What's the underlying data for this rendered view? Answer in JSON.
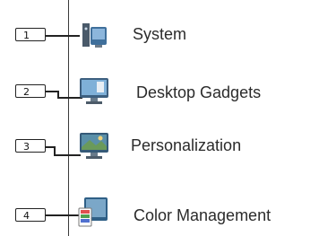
{
  "items": [
    {
      "number": "1",
      "label": "System",
      "icon": "system-icon"
    },
    {
      "number": "2",
      "label": "Desktop Gadgets",
      "icon": "desktop-gadgets-icon"
    },
    {
      "number": "3",
      "label": "Personalization",
      "icon": "personalization-icon"
    },
    {
      "number": "4",
      "label": "Color Management",
      "icon": "color-management-icon"
    }
  ]
}
